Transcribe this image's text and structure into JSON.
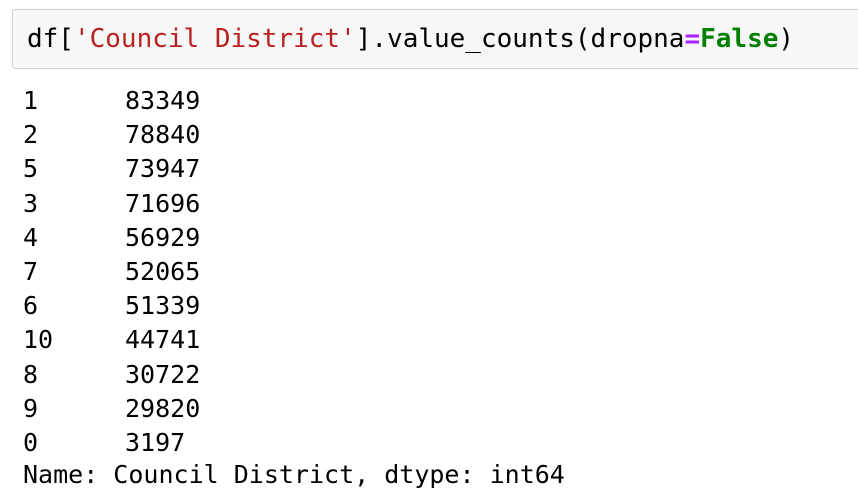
{
  "input": {
    "code_tokens": [
      {
        "text": "df[",
        "kind": "plain"
      },
      {
        "text": "'Council District'",
        "kind": "string"
      },
      {
        "text": "].value_counts(dropna",
        "kind": "plain"
      },
      {
        "text": "=",
        "kind": "operator"
      },
      {
        "text": "False",
        "kind": "keyword"
      },
      {
        "text": ")",
        "kind": "plain"
      }
    ]
  },
  "output": {
    "rows": [
      {
        "index": "1",
        "value": "83349"
      },
      {
        "index": "2",
        "value": "78840"
      },
      {
        "index": "5",
        "value": "73947"
      },
      {
        "index": "3",
        "value": "71696"
      },
      {
        "index": "4",
        "value": "56929"
      },
      {
        "index": "7",
        "value": "52065"
      },
      {
        "index": "6",
        "value": "51339"
      },
      {
        "index": "10",
        "value": "44741"
      },
      {
        "index": "8",
        "value": "30722"
      },
      {
        "index": "9",
        "value": "29820"
      },
      {
        "index": "0",
        "value": "3197"
      }
    ],
    "footer": "Name: Council District, dtype: int64"
  },
  "colors": {
    "cell_background": "#f7f7f7",
    "cell_border": "#cfcfcf",
    "string": "#ba2121",
    "operator": "#aa22ff",
    "keyword": "#008000"
  }
}
